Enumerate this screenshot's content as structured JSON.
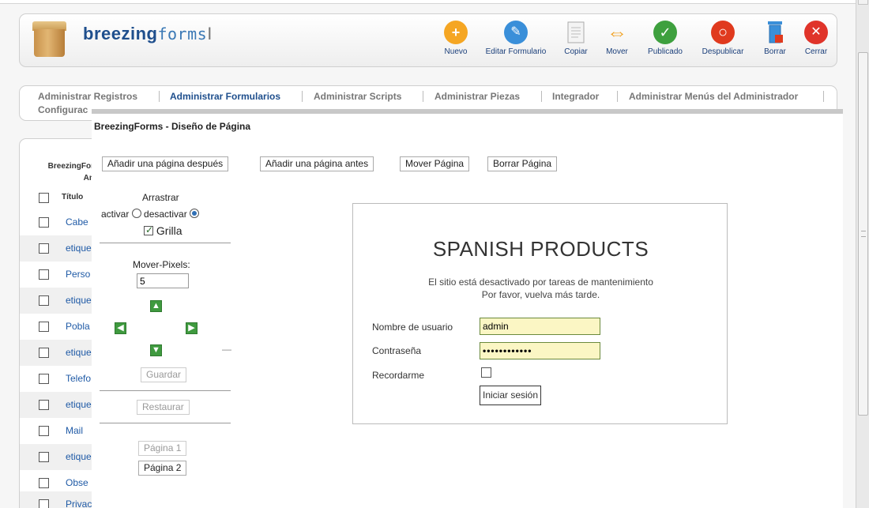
{
  "brand": {
    "name_bold": "breezing",
    "name_mono": "forms",
    "cursor_glyph": "I"
  },
  "toolbar": [
    {
      "id": "nuevo",
      "label": "Nuevo",
      "icon": "plus-icon",
      "color": "#f5a623",
      "glyph": "+"
    },
    {
      "id": "editar",
      "label": "Editar Formulario",
      "icon": "pencil-icon",
      "color": "#3a8fd9",
      "glyph": "✎"
    },
    {
      "id": "copiar",
      "label": "Copiar",
      "icon": "copy-icon",
      "color": "#cccccc",
      "glyph": ""
    },
    {
      "id": "mover",
      "label": "Mover",
      "icon": "move-arrows-icon",
      "color": "#f0a020",
      "glyph": "⇔"
    },
    {
      "id": "publicado",
      "label": "Publicado",
      "icon": "check-icon",
      "color": "#3ea03e",
      "glyph": "✓"
    },
    {
      "id": "despublicar",
      "label": "Despublicar",
      "icon": "unpublish-icon",
      "color": "#e03a1e",
      "glyph": "○"
    },
    {
      "id": "borrar",
      "label": "Borrar",
      "icon": "trash-icon",
      "color": "#3a8fd9",
      "glyph": ""
    },
    {
      "id": "cerrar",
      "label": "Cerrar",
      "icon": "close-icon",
      "color": "#e0342a",
      "glyph": "✕"
    }
  ],
  "tabs": {
    "items": [
      {
        "label": "Administrar Registros",
        "active": false
      },
      {
        "label": "Administrar Formularios",
        "active": true
      },
      {
        "label": "Administrar Scripts",
        "active": false
      },
      {
        "label": "Administrar Piezas",
        "active": false
      },
      {
        "label": "Integrador",
        "active": false
      },
      {
        "label": "Administrar Menús del Administrador",
        "active": false
      }
    ],
    "second_line": "Configurac"
  },
  "list": {
    "title_line1": "BreezingFor",
    "title_line2": "An",
    "header": "Título",
    "rows": [
      "Cabe",
      "etique",
      "Perso",
      "etique",
      "Pobla",
      "etique",
      "Telefo",
      "etique",
      "Mail",
      "etique",
      "Obse",
      "Privac"
    ]
  },
  "modal": {
    "title": "BreezingForms - Diseño de Página",
    "buttons": {
      "add_after": "Añadir una página después",
      "add_before": "Añadir una página antes",
      "move_page": "Mover Página",
      "delete_page": "Borrar Página"
    },
    "drag_label": "Arrastrar",
    "activate_label": "activar",
    "deactivate_label": "desactivar",
    "grid_label": "Grilla",
    "move_pixels_label": "Mover-Pixels:",
    "move_pixels_value": "5",
    "save_label": "Guardar",
    "restore_label": "Restaurar",
    "pages": [
      "Página 1",
      "Página 2"
    ],
    "dash_text": "—"
  },
  "preview": {
    "title": "SPANISH PRODUCTS",
    "message_line1": "El sitio está desactivado por tareas de mantenimiento",
    "message_line2": "Por favor, vuelva más tarde.",
    "username_label": "Nombre de usuario",
    "username_value": "admin",
    "password_label": "Contraseña",
    "password_value": "••••••••••••",
    "remember_label": "Recordarme",
    "login_button": "Iniciar sesión"
  }
}
